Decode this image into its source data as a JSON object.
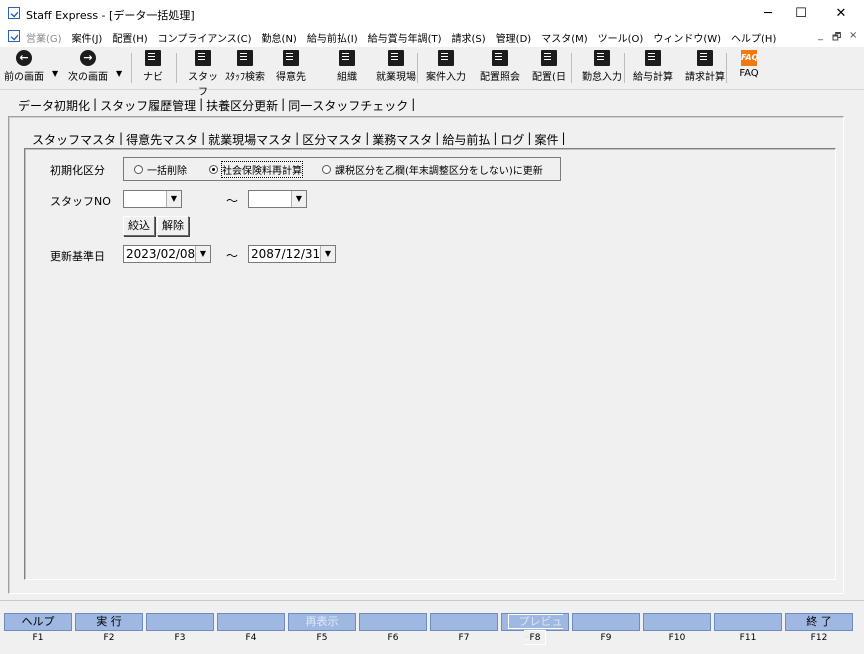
{
  "window": {
    "title": "Staff Express - [データ一括処理]",
    "controls": {
      "minimize": "─",
      "maximize": "☐",
      "close": "✕"
    }
  },
  "menu": {
    "items": [
      {
        "label": "営業(G)",
        "enabled": false
      },
      {
        "label": "案件(J)",
        "enabled": true
      },
      {
        "label": "配置(H)",
        "enabled": true
      },
      {
        "label": "コンプライアンス(C)",
        "enabled": true
      },
      {
        "label": "勤怠(N)",
        "enabled": true
      },
      {
        "label": "給与前払(I)",
        "enabled": true
      },
      {
        "label": "給与賞与年調(T)",
        "enabled": true
      },
      {
        "label": "請求(S)",
        "enabled": true
      },
      {
        "label": "管理(D)",
        "enabled": true
      },
      {
        "label": "マスタ(M)",
        "enabled": true
      },
      {
        "label": "ツール(O)",
        "enabled": true
      },
      {
        "label": "ウィンドウ(W)",
        "enabled": true
      },
      {
        "label": "ヘルプ(H)",
        "enabled": true
      }
    ],
    "mdi_controls": {
      "minimize": "_",
      "restore": "🗗",
      "close": "×"
    }
  },
  "toolbar": {
    "items": [
      {
        "label": "前の画面",
        "icon": "arrow-left-icon",
        "glyph": "←"
      },
      {
        "label": "次の画面",
        "icon": "arrow-right-icon",
        "glyph": "→"
      },
      {
        "label": "ナビ",
        "icon": "navi-icon"
      },
      {
        "label": "スタッフ",
        "icon": "staff-icon"
      },
      {
        "label": "ｽﾀｯﾌ検索",
        "icon": "staff-search-icon"
      },
      {
        "label": "得意先",
        "icon": "client-icon"
      },
      {
        "label": "組織",
        "icon": "organization-icon"
      },
      {
        "label": "就業現場",
        "icon": "worksite-icon"
      },
      {
        "label": "案件入力",
        "icon": "case-input-icon"
      },
      {
        "label": "配置照会",
        "icon": "placement-inquiry-icon"
      },
      {
        "label": "配置(日",
        "icon": "placement-daily-icon"
      },
      {
        "label": "勤怠入力",
        "icon": "attendance-input-icon"
      },
      {
        "label": "給与計算",
        "icon": "payroll-calc-icon"
      },
      {
        "label": "請求計算",
        "icon": "billing-calc-icon"
      },
      {
        "label": "FAQ",
        "icon": "faq-icon",
        "glyph": "FAQ"
      }
    ]
  },
  "main_tabs": [
    "データ初期化",
    "スタッフ履歴管理",
    "扶養区分更新",
    "同一スタッフチェック"
  ],
  "sub_tabs": [
    "スタッフマスタ",
    "得意先マスタ",
    "就業現場マスタ",
    "区分マスタ",
    "業務マスタ",
    "給与前払",
    "ログ",
    "案件"
  ],
  "form": {
    "init_label": "初期化区分",
    "radios": [
      {
        "label": "一括削除",
        "checked": false
      },
      {
        "label": "社会保険料再計算",
        "checked": true
      },
      {
        "label": "課税区分を乙欄(年末調整区分をしない)に更新",
        "checked": false
      }
    ],
    "staff_no_label": "スタッフNO",
    "staff_no_from": "",
    "staff_no_to": "",
    "range_sep": "～",
    "filter_button": "絞込",
    "clear_button": "解除",
    "base_date_label": "更新基準日",
    "base_date_from": "2023/02/08",
    "base_date_to": "2087/12/31"
  },
  "fkeys": [
    {
      "key": "F1",
      "label": "ヘルプ",
      "state": "enabled"
    },
    {
      "key": "F2",
      "label": "実 行",
      "state": "enabled"
    },
    {
      "key": "F3",
      "label": "",
      "state": "enabled"
    },
    {
      "key": "F4",
      "label": "",
      "state": "enabled"
    },
    {
      "key": "F5",
      "label": "再表示",
      "state": "disabled"
    },
    {
      "key": "F6",
      "label": "",
      "state": "enabled"
    },
    {
      "key": "F7",
      "label": "",
      "state": "enabled"
    },
    {
      "key": "F8",
      "label": "プレビュー",
      "state": "outlined"
    },
    {
      "key": "F9",
      "label": "",
      "state": "enabled"
    },
    {
      "key": "F10",
      "label": "",
      "state": "enabled"
    },
    {
      "key": "F11",
      "label": "",
      "state": "enabled"
    },
    {
      "key": "F12",
      "label": "終 了",
      "state": "enabled"
    }
  ]
}
